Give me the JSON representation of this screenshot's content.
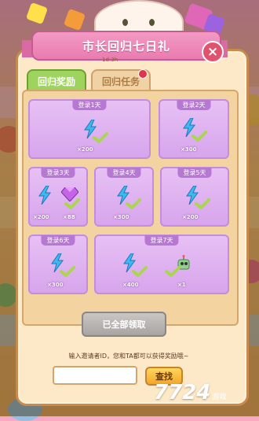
{
  "dialog": {
    "title": "市长回归七日礼",
    "timer": "1d:3h",
    "close_label": "×"
  },
  "tabs": [
    {
      "label": "回归奖励",
      "active": true
    },
    {
      "label": "回归任务",
      "active": false,
      "has_notification": true
    }
  ],
  "rewards": [
    {
      "day_label": "登录1天",
      "items": [
        {
          "icon": "energy-bolt-icon",
          "count": "×200"
        }
      ],
      "claimed": true
    },
    {
      "day_label": "登录2天",
      "items": [
        {
          "icon": "energy-bolt-icon",
          "count": "×300"
        }
      ],
      "claimed": true
    },
    {
      "day_label": "登录3天",
      "items": [
        {
          "icon": "energy-bolt-icon",
          "count": "×200"
        },
        {
          "icon": "purple-gem-icon",
          "count": "×88"
        }
      ],
      "claimed": true
    },
    {
      "day_label": "登录4天",
      "items": [
        {
          "icon": "energy-bolt-icon",
          "count": "×300"
        }
      ],
      "claimed": true
    },
    {
      "day_label": "登录5天",
      "items": [
        {
          "icon": "energy-bolt-icon",
          "count": "×200"
        }
      ],
      "claimed": true
    },
    {
      "day_label": "登录6天",
      "items": [
        {
          "icon": "energy-bolt-icon",
          "count": "×300"
        }
      ],
      "claimed": true
    },
    {
      "day_label": "登录7天",
      "items": [
        {
          "icon": "energy-bolt-icon",
          "count": "×400"
        },
        {
          "icon": "robot-helper-icon",
          "count": "×1"
        }
      ],
      "claimed": true
    }
  ],
  "claim_button": {
    "label": "已全部领取"
  },
  "invite": {
    "hint": "输入邀请者ID，您和TA都可以获得奖励哦~",
    "input_value": "",
    "input_placeholder": "",
    "search_label": "查找"
  },
  "watermark": {
    "number": "7724",
    "text": "游戏"
  },
  "colors": {
    "ribbon": "#e97bb0",
    "tab_active": "#9ed45d",
    "card": "#d7a5ec",
    "check": "#a8d84a",
    "bolt": "#3fb8f0"
  }
}
